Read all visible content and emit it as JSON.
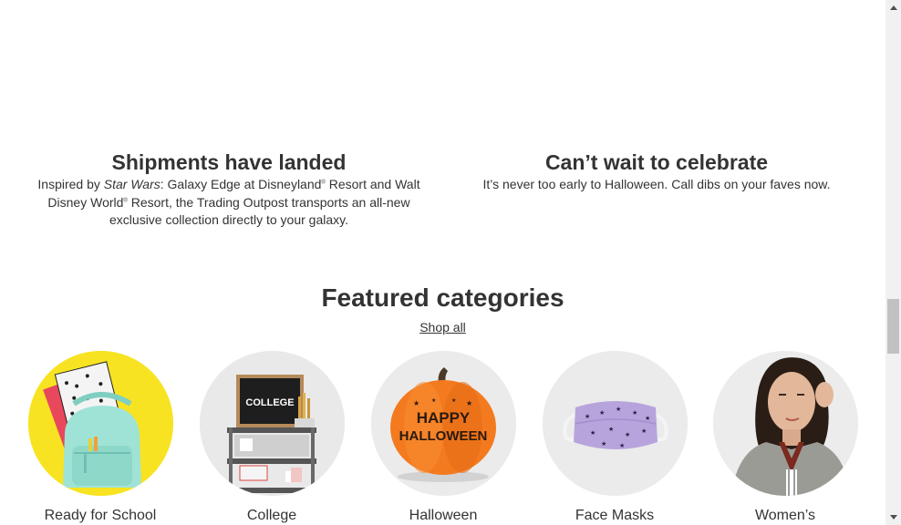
{
  "promos": [
    {
      "title": "Shipments have landed",
      "desc_part1": "Inspired by ",
      "desc_italic": "Star Wars",
      "desc_part2": ": Galaxy Edge at Disneyland",
      "desc_part3": " Resort and Walt Disney World",
      "desc_part4": " Resort, the Trading Outpost transports an all-new exclusive collection directly to your galaxy."
    },
    {
      "title": "Can’t wait to celebrate",
      "desc": "It’s never too early to Halloween. Call dibs on your faves now."
    }
  ],
  "featured": {
    "title": "Featured categories",
    "shop_all_label": "Shop all"
  },
  "categories": [
    {
      "label": "Ready for School",
      "bg": "#f7e322"
    },
    {
      "label": "College",
      "bg": "#e9e9e9",
      "sign_text": "COLLEGE"
    },
    {
      "label": "Halloween",
      "bg": "#ebebeb",
      "pumpkin_line1": "HAPPY",
      "pumpkin_line2": "HALLOWEEN"
    },
    {
      "label": "Face Masks",
      "bg": "#ebebeb"
    },
    {
      "label": "Women’s",
      "bg": "#ececec"
    }
  ],
  "colors": {
    "text": "#333333",
    "pumpkin": "#f47a1f",
    "mask": "#b7a4dc",
    "backpack": "#9fe3d6"
  }
}
